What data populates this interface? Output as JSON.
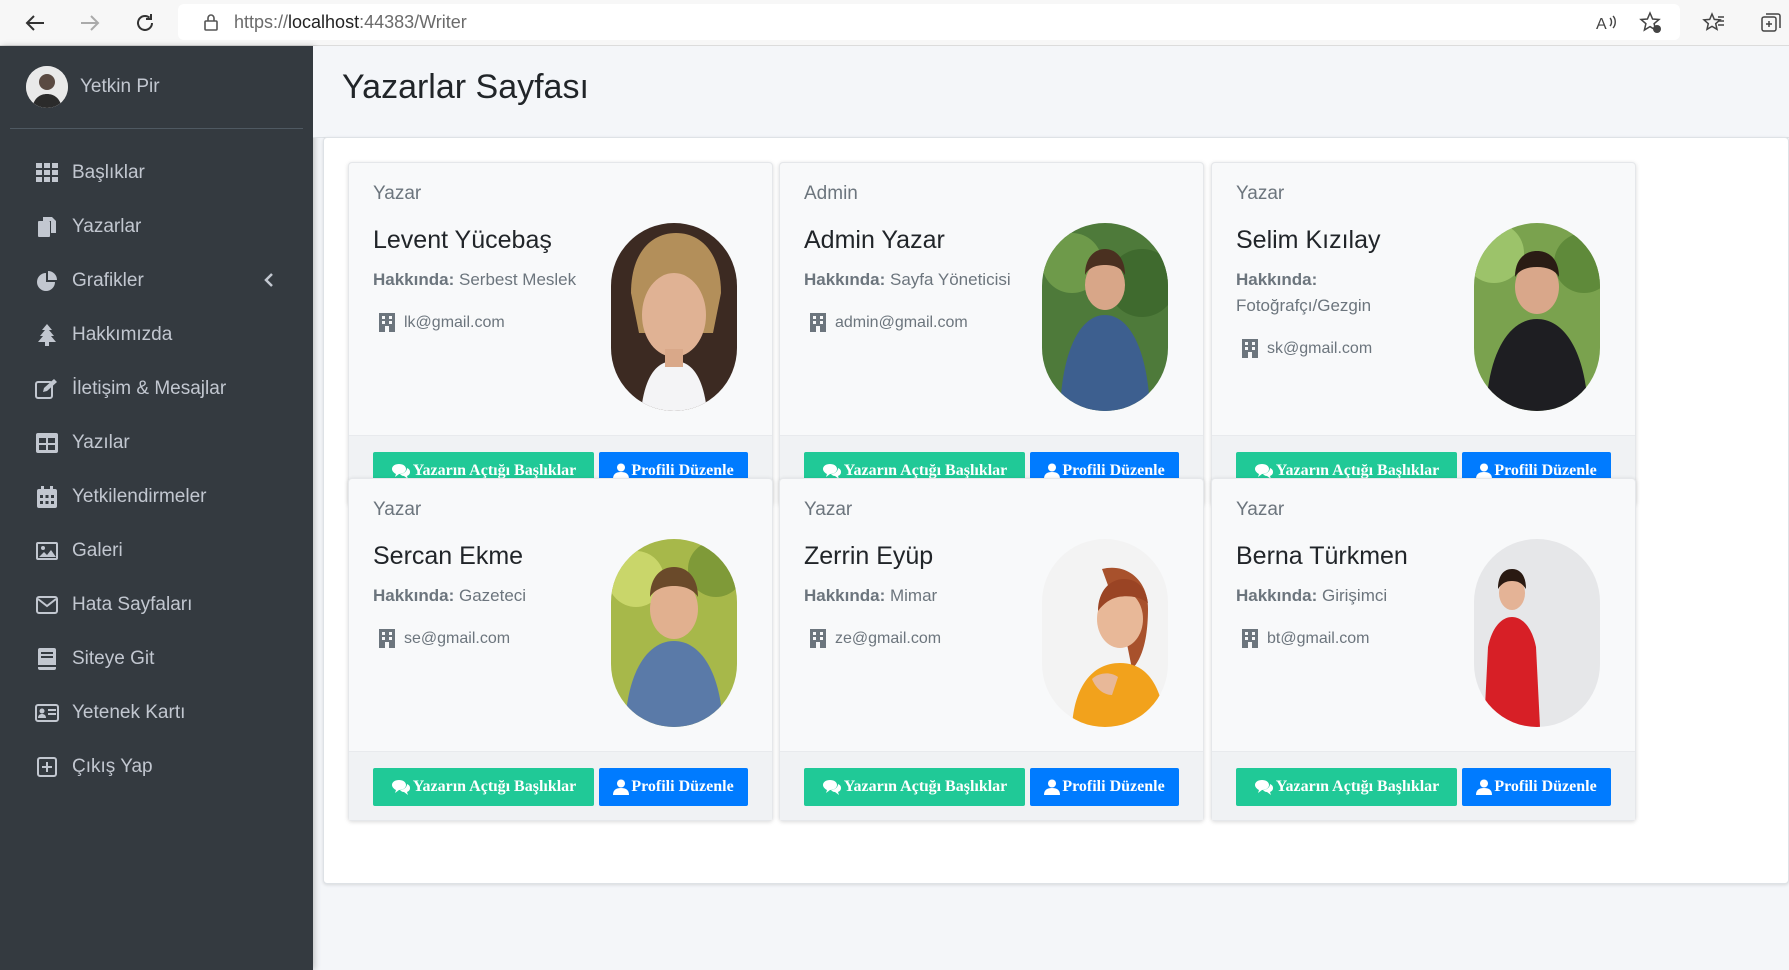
{
  "browser": {
    "url_prefix": "https://",
    "url_host": "localhost",
    "url_rest": ":44383/Writer"
  },
  "sidebar": {
    "user_name": "Yetkin Pir",
    "items": [
      {
        "label": "Başlıklar",
        "icon": "grid-icon"
      },
      {
        "label": "Yazarlar",
        "icon": "copy-icon"
      },
      {
        "label": "Grafikler",
        "icon": "pie-chart-icon"
      },
      {
        "label": "Hakkımızda",
        "icon": "tree-icon"
      },
      {
        "label": "İletişim & Mesajlar",
        "icon": "edit-icon"
      },
      {
        "label": "Yazılar",
        "icon": "table-icon"
      },
      {
        "label": "Yetkilendirmeler",
        "icon": "calendar-icon"
      },
      {
        "label": "Galeri",
        "icon": "image-icon"
      },
      {
        "label": "Hata Sayfaları",
        "icon": "envelope-icon"
      },
      {
        "label": "Siteye Git",
        "icon": "book-icon"
      },
      {
        "label": "Yetenek Kartı",
        "icon": "id-card-icon"
      },
      {
        "label": "Çıkış Yap",
        "icon": "plus-square-icon"
      }
    ]
  },
  "page": {
    "title": "Yazarlar Sayfası"
  },
  "labels": {
    "about": "Hakkında:",
    "topics_button": "Yazarın Açtığı Başlıklar",
    "edit_button": "Profili Düzenle"
  },
  "writers": [
    {
      "role": "Yazar",
      "name": "Levent Yücebaş",
      "about": "Serbest Meslek",
      "email": "lk@gmail.com"
    },
    {
      "role": "Admin",
      "name": "Admin Yazar",
      "about": "Sayfa Yöneticisi",
      "email": "admin@gmail.com"
    },
    {
      "role": "Yazar",
      "name": "Selim Kızılay",
      "about": "Fotoğrafçı/Gezgin",
      "email": "sk@gmail.com"
    },
    {
      "role": "Yazar",
      "name": "Sercan Ekme",
      "about": "Gazeteci",
      "email": "se@gmail.com"
    },
    {
      "role": "Yazar",
      "name": "Zerrin Eyüp",
      "about": "Mimar",
      "email": "ze@gmail.com"
    },
    {
      "role": "Yazar",
      "name": "Berna Türkmen",
      "about": "Girişimci",
      "email": "bt@gmail.com"
    }
  ],
  "colors": {
    "sidebar_bg": "#343a40",
    "accent_green": "#20c997",
    "accent_blue": "#007bff"
  }
}
